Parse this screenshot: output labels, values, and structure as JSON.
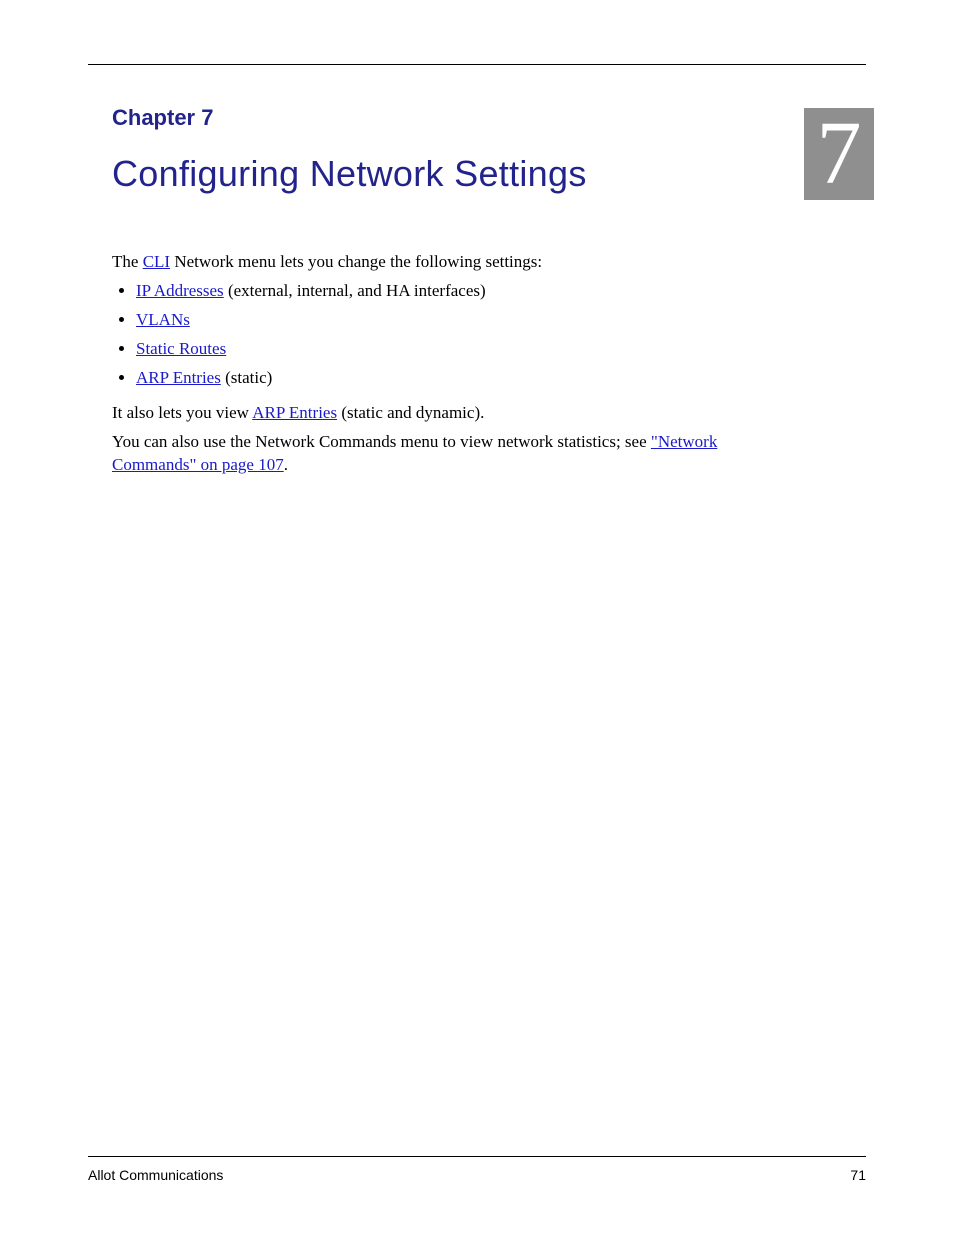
{
  "chapter": {
    "label": "Chapter 7",
    "number": "7",
    "title": "Configuring Network Settings"
  },
  "intro": {
    "lead_prefix": "The ",
    "lead_link": "CLI",
    "lead_suffix": " Network menu lets you change the following settings:"
  },
  "toc": [
    {
      "link": "IP Addresses",
      "tail": " (external, internal, and HA interfaces)"
    },
    {
      "link": "VLANs",
      "tail": ""
    },
    {
      "link": "Static Routes",
      "tail": ""
    },
    {
      "link": "ARP Entries",
      "tail": " (static)"
    }
  ],
  "followups": [
    {
      "pre": "It also lets you view ",
      "link": "ARP Entries",
      "post": " (static and dynamic)."
    },
    {
      "pre": "You can also use the Network Commands menu to view network statistics; see ",
      "link": "\"Network Commands\" on page 107",
      "post": "."
    }
  ],
  "footer": {
    "left": "Allot Communications",
    "right": "71"
  }
}
